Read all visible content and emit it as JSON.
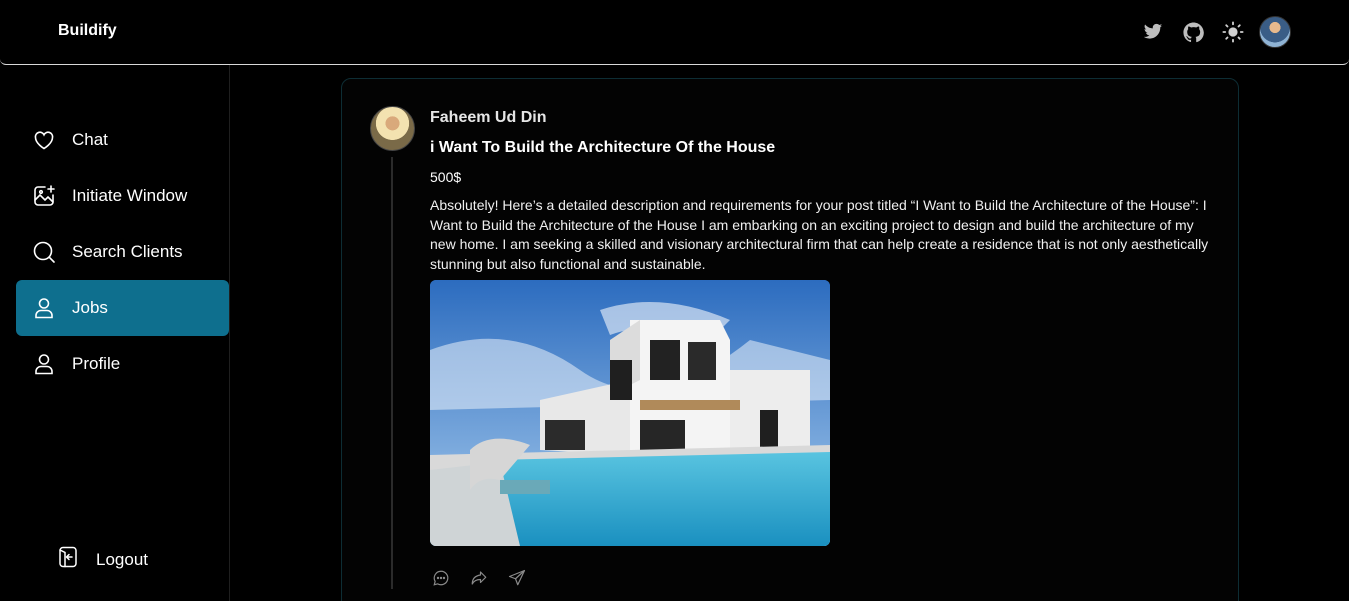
{
  "app": {
    "brand": "Buildify"
  },
  "header": {
    "icons": [
      "twitter-icon",
      "github-icon",
      "theme-toggle-icon",
      "user-avatar"
    ]
  },
  "sidebar": {
    "items": [
      {
        "label": "Chat",
        "icon": "heart-icon",
        "active": false
      },
      {
        "label": "Initiate Window",
        "icon": "image-plus-icon",
        "active": false
      },
      {
        "label": "Search Clients",
        "icon": "search-icon",
        "active": false
      },
      {
        "label": "Jobs",
        "icon": "user-icon",
        "active": true
      },
      {
        "label": "Profile",
        "icon": "user-icon",
        "active": false
      }
    ],
    "logout_label": "Logout"
  },
  "post": {
    "author": "Faheem Ud Din",
    "title": "i Want To Build the Architecture Of the House",
    "price": "500$",
    "description": "Absolutely! Here’s a detailed description and requirements for your post titled “I Want to Build the Architecture of the House”: I Want to Build the Architecture of the House I am embarking on an exciting project to design and build the architecture of my new home. I am seeking a skilled and visionary architectural firm that can help create a residence that is not only aesthetically stunning but also functional and sustainable.",
    "actions": [
      "comment-icon",
      "share-icon",
      "send-icon"
    ]
  },
  "colors": {
    "accent": "#0e6f8e",
    "background": "#000000"
  }
}
